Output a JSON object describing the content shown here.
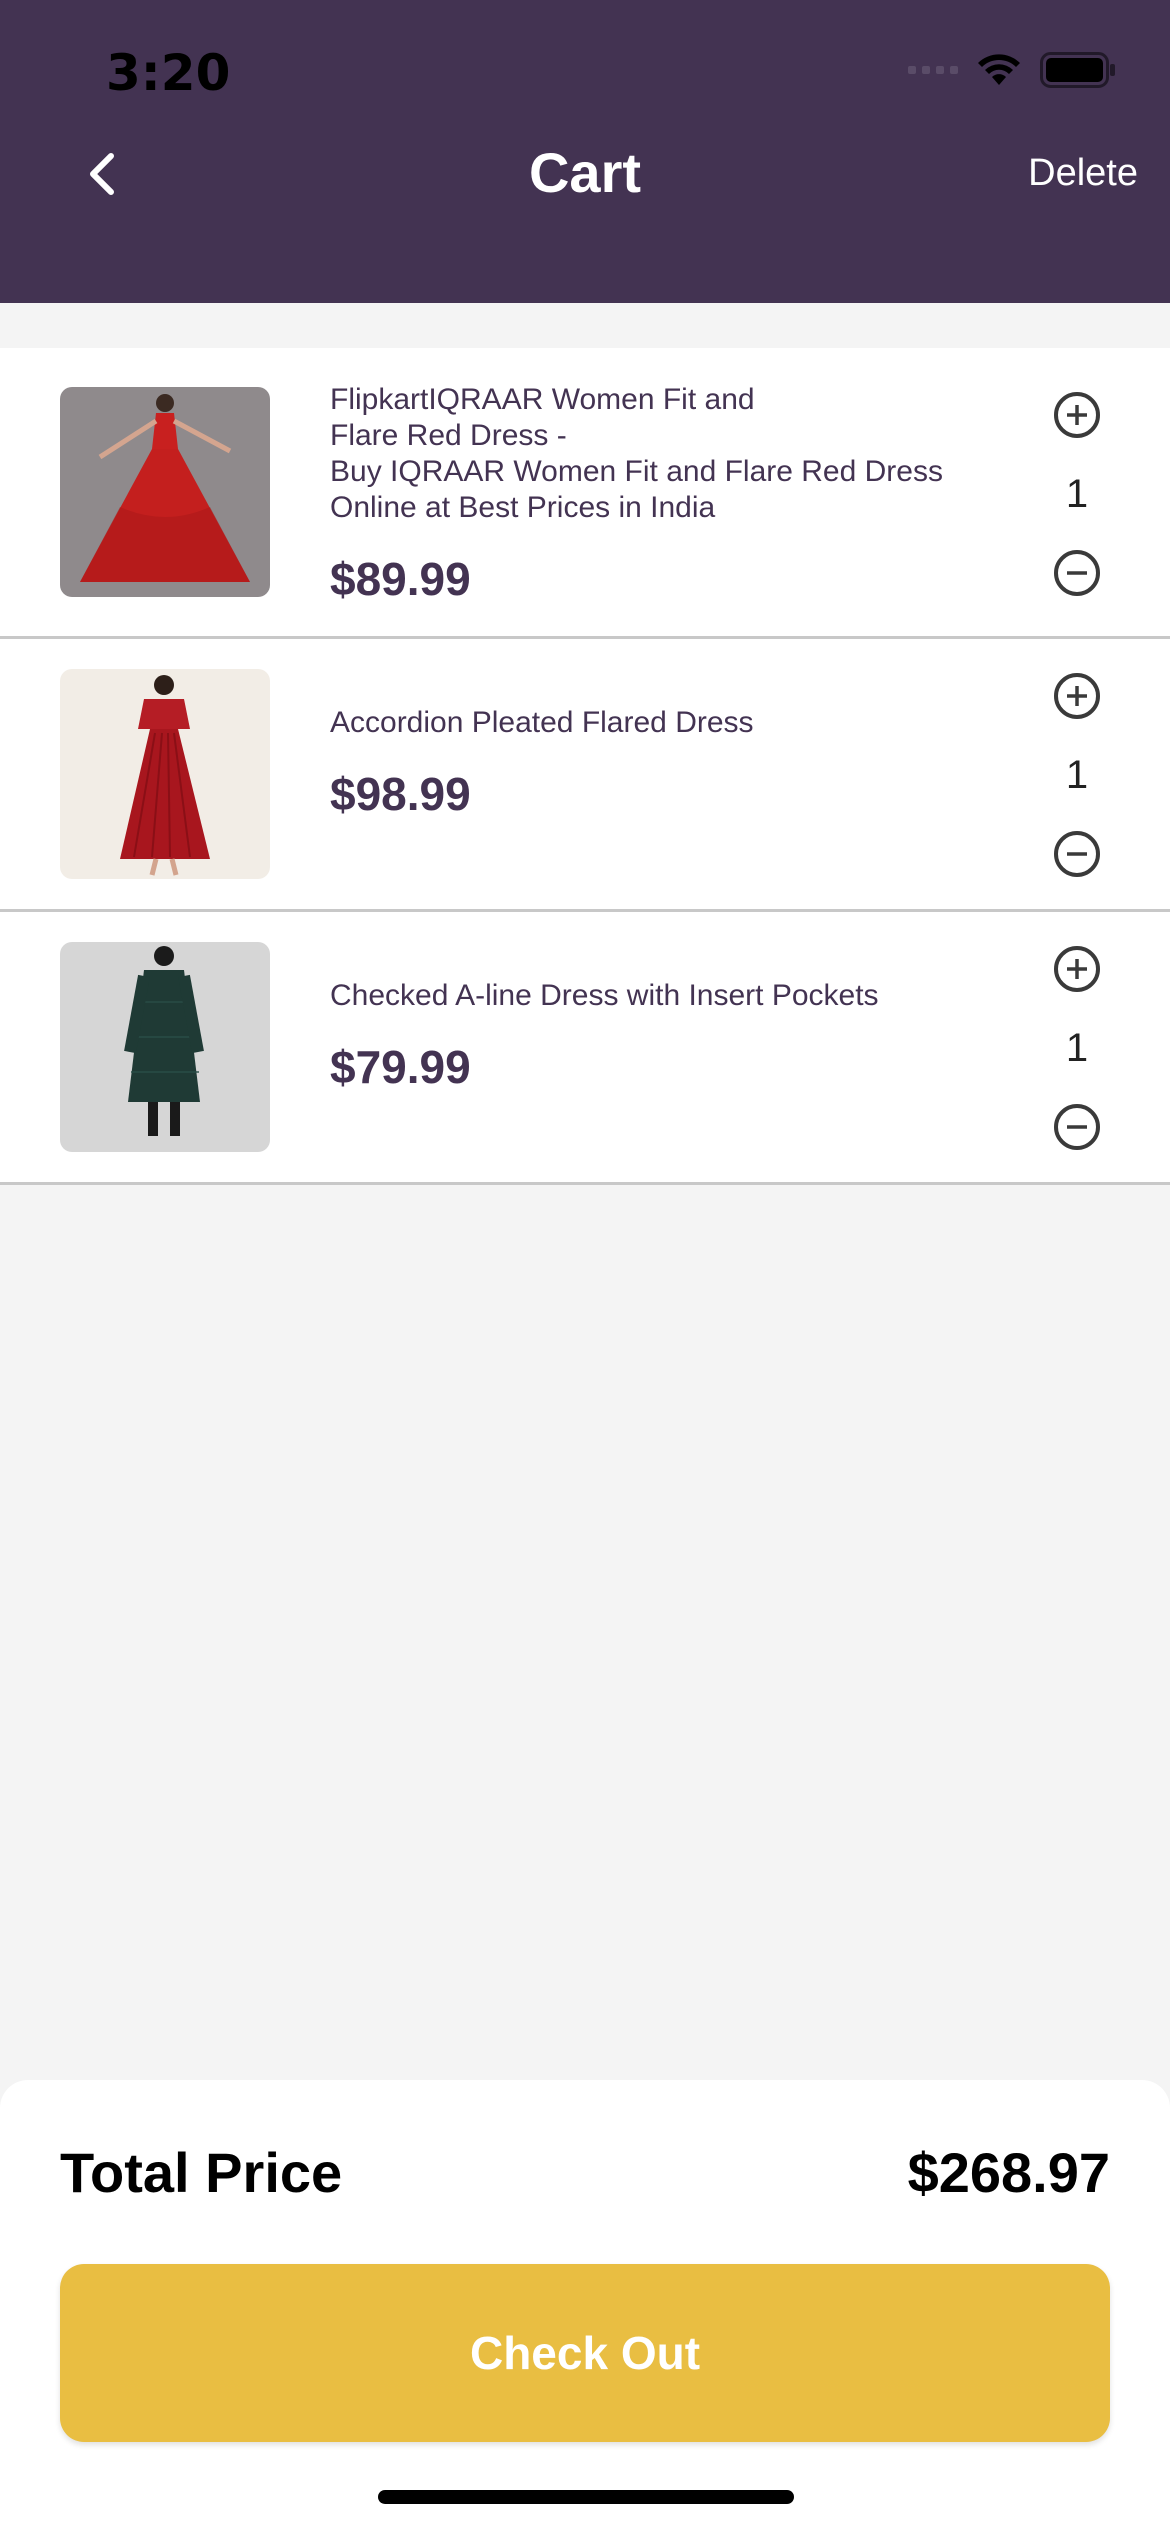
{
  "status_bar": {
    "time": "3:20"
  },
  "header": {
    "title": "Cart",
    "delete_label": "Delete"
  },
  "cart": {
    "items": [
      {
        "name": "FlipkartIQRAAR Women Fit and\nFlare Red Dress -\nBuy IQRAAR Women Fit and Flare Red Dress\nOnline at Best Prices in India",
        "price": "$89.99",
        "quantity": "1"
      },
      {
        "name": "Accordion Pleated Flared Dress",
        "price": "$98.99",
        "quantity": "1"
      },
      {
        "name": "Checked A-line Dress with Insert Pockets",
        "price": "$79.99",
        "quantity": "1"
      }
    ]
  },
  "footer": {
    "total_label": "Total Price",
    "total_value": "$268.97",
    "checkout_label": "Check Out"
  },
  "colors": {
    "header": "#433352",
    "accent": "#e9be42",
    "text": "#433352",
    "background": "#f4f4f4"
  }
}
